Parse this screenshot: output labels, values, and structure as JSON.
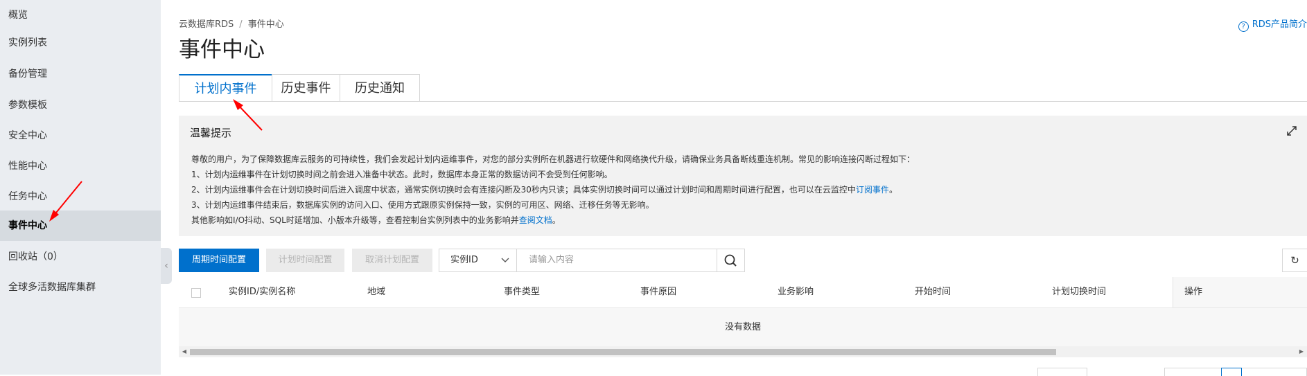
{
  "sidebar": {
    "items": [
      {
        "label": "概览"
      },
      {
        "label": "实例列表"
      },
      {
        "label": "备份管理"
      },
      {
        "label": "参数模板"
      },
      {
        "label": "安全中心"
      },
      {
        "label": "性能中心"
      },
      {
        "label": "任务中心"
      },
      {
        "label": "事件中心",
        "active": true
      },
      {
        "label": "回收站（0）"
      },
      {
        "label": "全球多活数据库集群"
      }
    ]
  },
  "header": {
    "breadcrumb": [
      "云数据库RDS",
      "事件中心"
    ],
    "breadcrumb_sep": "/",
    "title": "事件中心",
    "help_link": "RDS产品简介"
  },
  "tabs": [
    {
      "label": "计划内事件",
      "active": true
    },
    {
      "label": "历史事件"
    },
    {
      "label": "历史通知"
    }
  ],
  "notice": {
    "title": "温馨提示",
    "line1": "尊敬的用户，为了保障数据库云服务的可持续性，我们会发起计划内运维事件，对您的部分实例所在机器进行软硬件和网络换代升级，请确保业务具备断线重连机制。常见的影响连接闪断过程如下：",
    "line2": "1、计划内运维事件在计划切换时间之前会进入准备中状态。此时，数据库本身正常的数据访问不会受到任何影响。",
    "line3": "2、计划内运维事件会在计划切换时间后进入调度中状态，通常实例切换时会有连接闪断及30秒内只读；具体实例切换时间可以通过计划时间和周期时间进行配置，也可以在云监控中",
    "line3_link": "订阅事件",
    "line3_end": "。",
    "line4": "3、计划内运维事件结束后，数据库实例的访问入口、使用方式跟原实例保持一致，实例的可用区、网络、迁移任务等无影响。",
    "line5": "其他影响如I/O抖动、SQL时延增加、小版本升级等，查看控制台实例列表中的业务影响并",
    "line5_link": "查阅文档",
    "line5_end": "。"
  },
  "toolbar": {
    "cycle_config": "周期时间配置",
    "plan_config": "计划时间配置",
    "cancel_config": "取消计划配置",
    "filter_select": "实例ID",
    "search_placeholder": "请输入内容"
  },
  "table": {
    "columns": [
      "实例ID/实例名称",
      "地域",
      "事件类型",
      "事件原因",
      "业务影响",
      "开始时间",
      "计划切换时间",
      "操作"
    ],
    "empty_text": "没有数据"
  },
  "colors": {
    "accent": "#0070cc",
    "annotation": "#ff0000"
  }
}
